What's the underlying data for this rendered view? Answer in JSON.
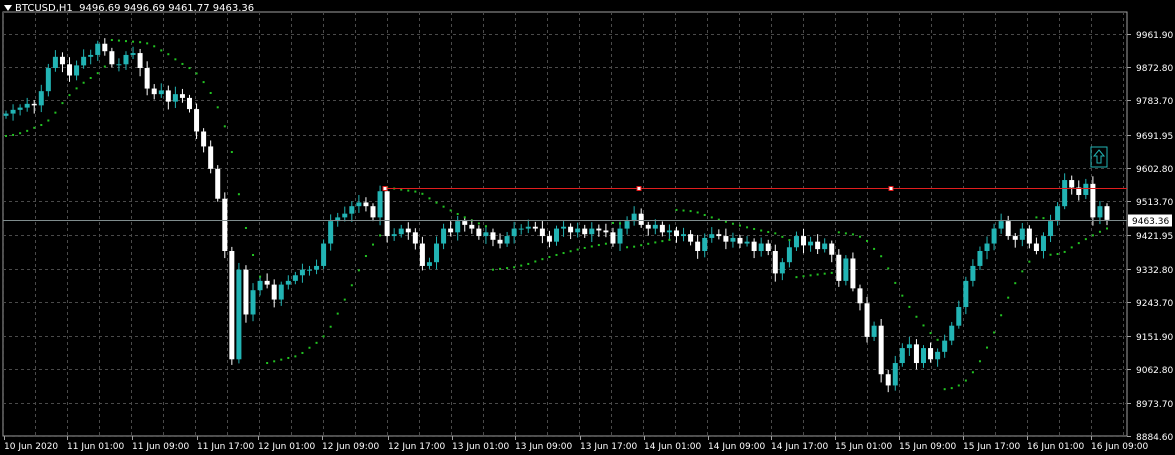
{
  "header": {
    "symbol_timeframe": "BTCUSD,H1",
    "ohlc": "9496.69 9496.69 9461.77 9463.36"
  },
  "colors": {
    "background": "#000000",
    "grid": "#4a4a4a",
    "frame": "#a0a0a0",
    "bull": "#22b4b4",
    "bear": "#ffffff",
    "sar": "#22c322",
    "level": "#e11e1e",
    "price_line": "#7f8c8d"
  },
  "chart_data": {
    "type": "candlestick",
    "symbol": "BTCUSD",
    "timeframe": "H1",
    "ylim": [
      8884.6,
      10020
    ],
    "y_ticks": [
      "9961.90",
      "9872.80",
      "9783.70",
      "9691.95",
      "9602.80",
      "9513.70",
      "9421.95",
      "9332.80",
      "9243.70",
      "9151.90",
      "9062.80",
      "8973.70",
      "8884.60"
    ],
    "x_ticks": [
      "10 Jun 2020",
      "11 Jun 01:00",
      "11 Jun 09:00",
      "11 Jun 17:00",
      "12 Jun 01:00",
      "12 Jun 09:00",
      "12 Jun 17:00",
      "13 Jun 01:00",
      "13 Jun 09:00",
      "13 Jun 17:00",
      "14 Jun 01:00",
      "14 Jun 09:00",
      "14 Jun 17:00",
      "15 Jun 01:00",
      "15 Jun 09:00",
      "15 Jun 17:00",
      "16 Jun 01:00",
      "16 Jun 09:00"
    ],
    "current_price": "9463.36",
    "horizontal_level": 9548,
    "closes": [
      9748,
      9758,
      9764,
      9774,
      9770,
      9808,
      9870,
      9900,
      9880,
      9850,
      9877,
      9900,
      9905,
      9935,
      9915,
      9880,
      9880,
      9905,
      9910,
      9870,
      9815,
      9800,
      9810,
      9780,
      9800,
      9790,
      9760,
      9700,
      9660,
      9600,
      9520,
      9380,
      9090,
      9330,
      9210,
      9275,
      9300,
      9290,
      9250,
      9290,
      9300,
      9315,
      9330,
      9330,
      9340,
      9400,
      9460,
      9470,
      9480,
      9500,
      9510,
      9500,
      9470,
      9540,
      9420,
      9425,
      9440,
      9430,
      9400,
      9340,
      9350,
      9400,
      9440,
      9430,
      9460,
      9450,
      9440,
      9420,
      9430,
      9410,
      9400,
      9420,
      9440,
      9440,
      9445,
      9440,
      9420,
      9405,
      9440,
      9445,
      9430,
      9440,
      9425,
      9440,
      9435,
      9430,
      9400,
      9440,
      9460,
      9480,
      9450,
      9440,
      9450,
      9430,
      9435,
      9420,
      9425,
      9405,
      9380,
      9415,
      9425,
      9420,
      9405,
      9415,
      9400,
      9405,
      9380,
      9400,
      9380,
      9320,
      9350,
      9390,
      9420,
      9395,
      9405,
      9385,
      9400,
      9370,
      9300,
      9360,
      9280,
      9240,
      9150,
      9180,
      9050,
      9020,
      9080,
      9120,
      9130,
      9080,
      9120,
      9090,
      9110,
      9140,
      9180,
      9230,
      9300,
      9340,
      9380,
      9400,
      9440,
      9460,
      9420,
      9410,
      9440,
      9400,
      9380,
      9420,
      9460,
      9500,
      9570,
      9550,
      9530,
      9560,
      9470,
      9500,
      9463.36
    ]
  }
}
